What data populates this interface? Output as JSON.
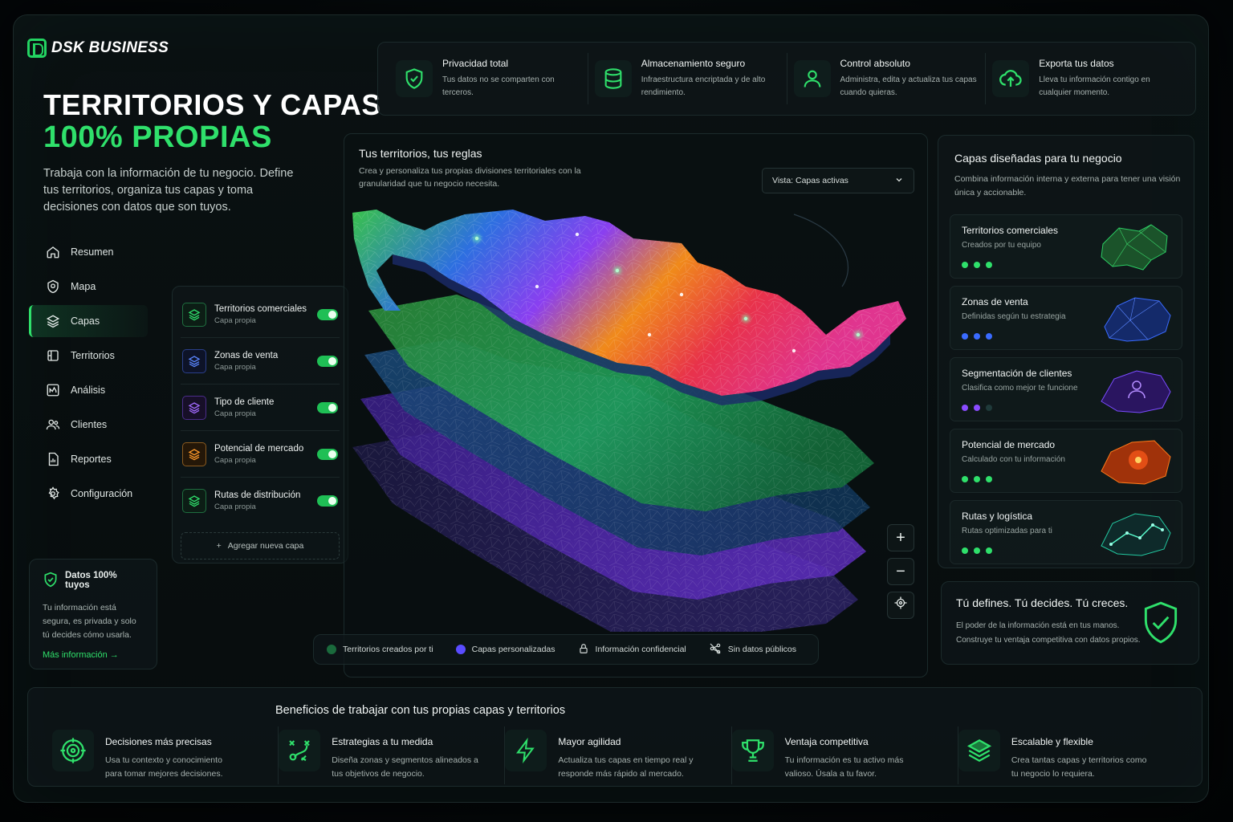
{
  "brand": {
    "name": "DSK BUSINESS"
  },
  "hero": {
    "title": "TERRITORIOS Y CAPAS",
    "subtitle": "100% PROPIAS",
    "description": "Trabaja con la información de tu negocio. Define tus territorios, organiza tus capas y toma decisiones con datos que son tuyos."
  },
  "nav": {
    "items": [
      {
        "label": "Resumen",
        "icon": "home-icon"
      },
      {
        "label": "Mapa",
        "icon": "map-pin-icon"
      },
      {
        "label": "Capas",
        "icon": "layers-icon",
        "active": true
      },
      {
        "label": "Territorios",
        "icon": "territory-icon"
      },
      {
        "label": "Análisis",
        "icon": "chart-icon"
      },
      {
        "label": "Clientes",
        "icon": "users-icon"
      },
      {
        "label": "Reportes",
        "icon": "report-icon"
      },
      {
        "label": "Configuración",
        "icon": "gear-icon"
      }
    ]
  },
  "trust": {
    "title": "Datos 100% tuyos",
    "body": "Tu información está segura, es privada y solo tú decides cómo usarla.",
    "link": "Más información"
  },
  "layers": {
    "items": [
      {
        "name": "Territorios comerciales",
        "type": "Capa propia",
        "color": "#2fe06b",
        "on": true
      },
      {
        "name": "Zonas de venta",
        "type": "Capa propia",
        "color": "#4a7bff",
        "on": true
      },
      {
        "name": "Tipo de cliente",
        "type": "Capa propia",
        "color": "#9b5cff",
        "on": true
      },
      {
        "name": "Potencial de mercado",
        "type": "Capa propia",
        "color": "#ff9a2a",
        "on": true
      },
      {
        "name": "Rutas de distribución",
        "type": "Capa propia",
        "color": "#2fe06b",
        "on": true
      }
    ],
    "add_label": "Agregar nueva capa"
  },
  "features": [
    {
      "title": "Privacidad total",
      "desc": "Tus datos no se comparten con terceros.",
      "icon": "shield-check-icon"
    },
    {
      "title": "Almacenamiento seguro",
      "desc": "Infraestructura encriptada y de alto rendimiento.",
      "icon": "database-icon"
    },
    {
      "title": "Control absoluto",
      "desc": "Administra, edita y actualiza tus capas cuando quieras.",
      "icon": "user-icon"
    },
    {
      "title": "Exporta tus datos",
      "desc": "Lleva tu información contigo en cualquier momento.",
      "icon": "cloud-upload-icon"
    }
  ],
  "map": {
    "title": "Tus territorios, tus reglas",
    "description": "Crea y personaliza tus propias divisiones territoriales con la granularidad que tu negocio necesita.",
    "view_select": "Vista: Capas activas"
  },
  "legend": [
    {
      "label": "Territorios creados por ti",
      "color": "#1f7a45",
      "icon": "dot"
    },
    {
      "label": "Capas personalizadas",
      "color": "#5a4cff",
      "icon": "dot"
    },
    {
      "label": "Información confidencial",
      "icon": "lock-icon"
    },
    {
      "label": "Sin datos públicos",
      "icon": "no-share-icon"
    }
  ],
  "right_panel": {
    "title": "Capas diseñadas para tu negocio",
    "description": "Combina información interna y externa para tener una visión única y accionable.",
    "cards": [
      {
        "title": "Territorios comerciales",
        "sub": "Creados por tu equipo",
        "color": "#2fe06b"
      },
      {
        "title": "Zonas de venta",
        "sub": "Definidas según tu estrategia",
        "color": "#3a6bff"
      },
      {
        "title": "Segmentación de clientes",
        "sub": "Clasifica como mejor te funcione",
        "color": "#8a4cff"
      },
      {
        "title": "Potencial de mercado",
        "sub": "Calculado con tu información",
        "color": "#ff7a1a"
      },
      {
        "title": "Rutas y logística",
        "sub": "Rutas optimizadas para ti",
        "color": "#23c8a0"
      }
    ]
  },
  "decide": {
    "title": "Tú defines. Tú decides. Tú creces.",
    "desc": "El poder de la información está en tus manos. Construye tu ventaja competitiva con datos propios."
  },
  "benefits": {
    "title": "Beneficios de trabajar con tus propias capas y territorios",
    "items": [
      {
        "name": "Decisiones más precisas",
        "desc": "Usa tu contexto y conocimiento para tomar mejores decisiones.",
        "icon": "target-icon"
      },
      {
        "name": "Estrategias a tu medida",
        "desc": "Diseña zonas y segmentos alineados a tus objetivos de negocio.",
        "icon": "strategy-icon"
      },
      {
        "name": "Mayor agilidad",
        "desc": "Actualiza tus capas en tiempo real y responde más rápido al mercado.",
        "icon": "lightning-icon"
      },
      {
        "name": "Ventaja competitiva",
        "desc": "Tu información es tu activo más valioso. Úsala a tu favor.",
        "icon": "trophy-icon"
      },
      {
        "name": "Escalable y flexible",
        "desc": "Crea tantas capas y territorios como tu negocio lo requiera.",
        "icon": "stack-icon"
      }
    ]
  }
}
